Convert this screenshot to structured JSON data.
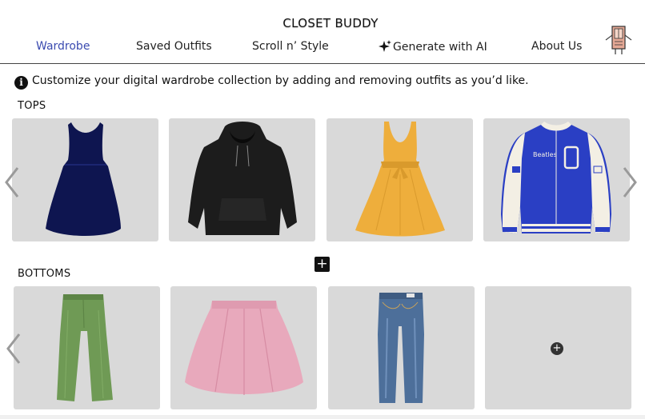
{
  "header": {
    "title": "CLOSET BUDDY",
    "nav": [
      {
        "label": "Wardrobe",
        "active": true
      },
      {
        "label": "Saved Outfits",
        "active": false
      },
      {
        "label": "Scroll n’ Style",
        "active": false
      },
      {
        "label": "Generate with AI",
        "active": false,
        "icon": "sparkle-icon"
      },
      {
        "label": "About Us",
        "active": false
      }
    ],
    "avatar_icon": "wardrobe-avatar-icon"
  },
  "info": {
    "icon": "info-icon",
    "text": "Customize your digital wardrobe collection by adding and removing outfits as you’d like."
  },
  "sections": {
    "tops": {
      "label": "TOPS",
      "items": [
        {
          "name": "navy-dress",
          "color": "#0e1550"
        },
        {
          "name": "black-hoodie",
          "color": "#1c1c1c"
        },
        {
          "name": "yellow-dress",
          "color": "#eeae3c"
        },
        {
          "name": "varsity-jacket",
          "color": "#2a3fc4",
          "text": "Beatles"
        }
      ]
    },
    "bottoms": {
      "label": "BOTTOMS",
      "items": [
        {
          "name": "green-pants",
          "color": "#6f9a55"
        },
        {
          "name": "pink-skirt",
          "color": "#e8a9bc"
        },
        {
          "name": "blue-jeans",
          "color": "#4d6f9a"
        },
        {
          "name": "add-item",
          "icon": "plus-circle-icon"
        }
      ]
    }
  },
  "controls": {
    "add_label": "+",
    "add_card_label": "+",
    "arrows": [
      "chevron-left-icon",
      "chevron-right-icon"
    ]
  },
  "colors": {
    "accent": "#3b4bb0",
    "card_bg": "#d9d9d9",
    "text": "#111111"
  }
}
